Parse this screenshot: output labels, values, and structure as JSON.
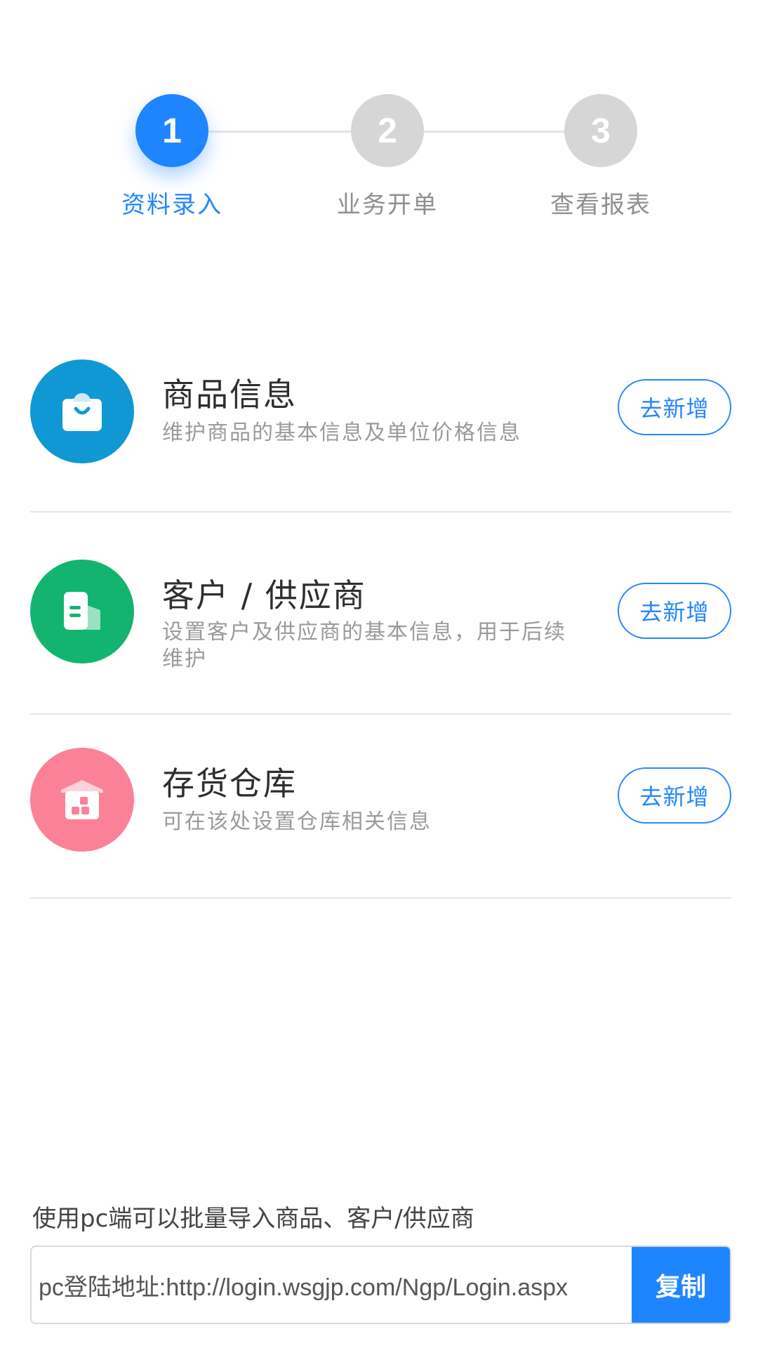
{
  "stepper": {
    "steps": [
      {
        "number": "1",
        "label": "资料录入",
        "active": true
      },
      {
        "number": "2",
        "label": "业务开单",
        "active": false
      },
      {
        "number": "3",
        "label": "查看报表",
        "active": false
      }
    ]
  },
  "items": [
    {
      "icon": "shopping-bag-icon",
      "color": "#0f98d3",
      "title": "商品信息",
      "description": "维护商品的基本信息及单位价格信息",
      "button_label": "去新增"
    },
    {
      "icon": "building-icon",
      "color": "#12b46f",
      "title": "客户 / 供应商",
      "description": "设置客户及供应商的基本信息，用于后续维护",
      "button_label": "去新增"
    },
    {
      "icon": "warehouse-icon",
      "color": "#fb8198",
      "title": "存货仓库",
      "description": "可在该处设置仓库相关信息",
      "button_label": "去新增"
    }
  ],
  "footer": {
    "import_tip": "使用pc端可以批量导入商品、客户/供应商",
    "login_url_text": "pc登陆地址:http://login.wsgjp.com/Ngp/Login.aspx",
    "copy_label": "复制"
  },
  "colors": {
    "primary": "#1f85ff",
    "inactive_step": "#d6d6d6"
  }
}
